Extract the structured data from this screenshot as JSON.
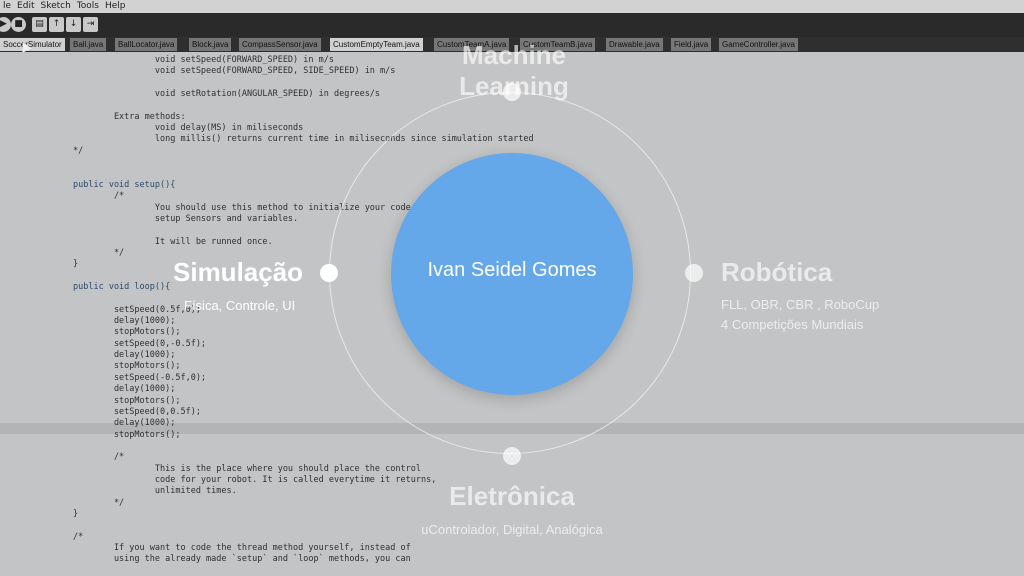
{
  "menu": [
    "le",
    "Edit",
    "Sketch",
    "Tools",
    "Help"
  ],
  "toolbar": {
    "run_icon": "▶",
    "stop_icon": "■",
    "new_icon": "▤",
    "open_icon": "↑",
    "save_icon": "↓",
    "export_icon": "⇥"
  },
  "tabs": [
    "SoccerSimulator",
    "Ball.java",
    "BallLocator.java",
    "Block.java",
    "CompassSensor.java",
    "CustomEmptyTeam.java",
    "CustomTeamA.java",
    "CustomTeamB.java",
    "Drawable.java",
    "Field.java",
    "GameController.java"
  ],
  "code": [
    "                void setSpeed(FORWARD_SPEED) in m/s",
    "                void setSpeed(FORWARD_SPEED, SIDE_SPEED) in m/s",
    "",
    "                void setRotation(ANGULAR_SPEED) in degrees/s",
    "",
    "        Extra methods:",
    "                void delay(MS) in miliseconds",
    "                long millis() returns current time in miliseconds since simulation started",
    "*/",
    "",
    "",
    "public void setup(){",
    "        /*",
    "                You should use this method to initialize your code,",
    "                setup Sensors and variables.",
    "",
    "                It will be runned once.",
    "        */",
    "}",
    "",
    "public void loop(){",
    "",
    "        setSpeed(0.5f,0);",
    "        delay(1000);",
    "        stopMotors();",
    "        setSpeed(0,-0.5f);",
    "        delay(1000);",
    "        stopMotors();",
    "        setSpeed(-0.5f,0);",
    "        delay(1000);",
    "        stopMotors();",
    "        setSpeed(0,0.5f);",
    "        delay(1000);",
    "        stopMotors();",
    "",
    "        /*",
    "                This is the place where you should place the control",
    "                code for your robot. It is called everytime it returns,",
    "                unlimited times.",
    "        */",
    "}",
    "",
    "/*",
    "        If you want to code the thread method yourself, instead of",
    "        using the already made `setup` and `loop` methods, you can"
  ],
  "overlay": {
    "center": "Ivan Seidel Gomes",
    "top_title": "Machine Learning",
    "left_title": "Simulação",
    "left_sub": "Física, Controle, UI",
    "right_title": "Robótica",
    "right_sub_1": "FLL, OBR, CBR , RoboCup",
    "right_sub_2": "4 Competições Mundiais",
    "bottom_title": "Eletrônica",
    "bottom_sub": "uControlador, Digital, Analógica"
  },
  "colors": {
    "center_circle": "#64a8ea",
    "background": "#c6c7c8"
  }
}
